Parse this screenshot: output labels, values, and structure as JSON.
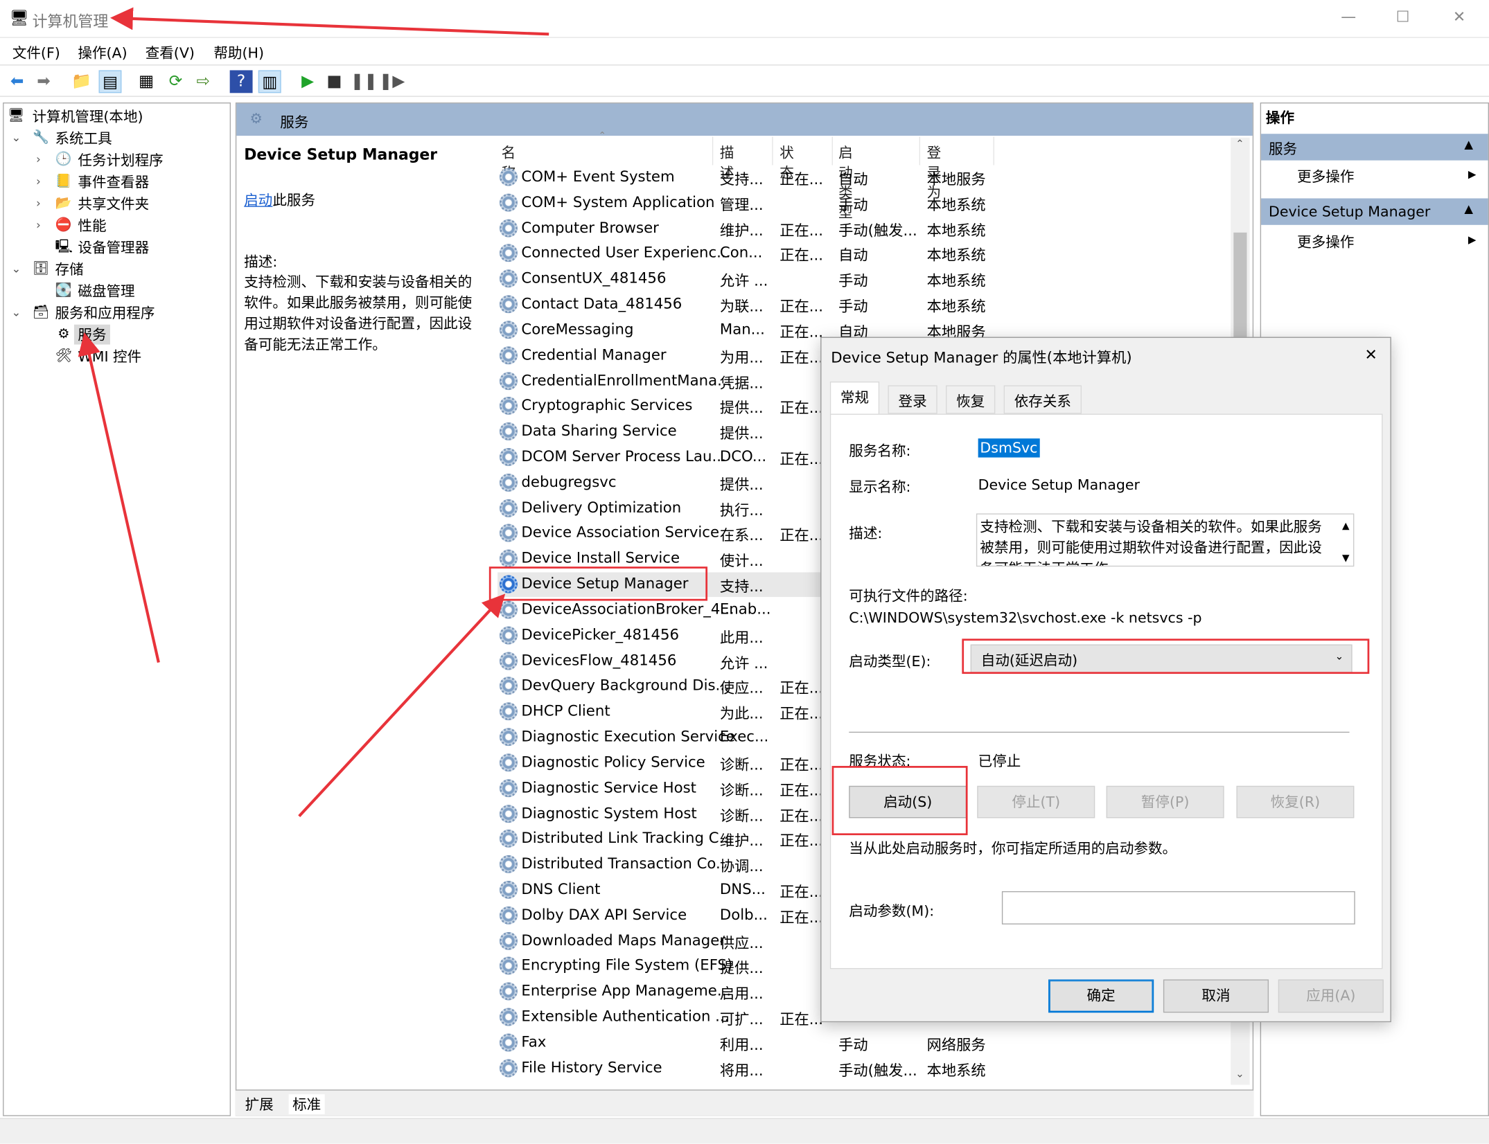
{
  "window": {
    "title": "计算机管理",
    "minimize": "—",
    "maximize": "☐",
    "close": "✕"
  },
  "menu": [
    "文件(F)",
    "操作(A)",
    "查看(V)",
    "帮助(H)"
  ],
  "toolbar": [
    "back-icon",
    "forward-icon",
    "up-folder-icon",
    "show-hide-tree-icon",
    "properties-icon",
    "refresh-icon",
    "export-list-icon",
    "help-icon",
    "show-hide-action-icon",
    "play-icon",
    "stop-icon",
    "pause-icon",
    "resume-icon"
  ],
  "tree": {
    "root": "计算机管理(本地)",
    "items": [
      {
        "label": "系统工具",
        "level": 1,
        "expanded": true
      },
      {
        "label": "任务计划程序",
        "level": 2
      },
      {
        "label": "事件查看器",
        "level": 2
      },
      {
        "label": "共享文件夹",
        "level": 2
      },
      {
        "label": "性能",
        "level": 2
      },
      {
        "label": "设备管理器",
        "level": 2
      },
      {
        "label": "存储",
        "level": 1,
        "expanded": true
      },
      {
        "label": "磁盘管理",
        "level": 2
      },
      {
        "label": "服务和应用程序",
        "level": 1,
        "expanded": true
      },
      {
        "label": "服务",
        "level": 2,
        "selected": true
      },
      {
        "label": "WMI 控件",
        "level": 2
      }
    ]
  },
  "services": {
    "header": "服务",
    "detail": {
      "title": "Device Setup Manager",
      "start_link": "启动",
      "start_suffix": "此服务",
      "desc_label": "描述:",
      "desc": "支持检测、下载和安装与设备相关的软件。如果此服务被禁用，则可能使用过期软件对设备进行配置，因此设备可能无法正常工作。"
    },
    "columns": [
      "名称",
      "描述",
      "状态",
      "启动类型",
      "登录为"
    ],
    "rows": [
      [
        "COM+ Event System",
        "支持...",
        "正在...",
        "自动",
        "本地服务"
      ],
      [
        "COM+ System Application",
        "管理...",
        "",
        "手动",
        "本地系统"
      ],
      [
        "Computer Browser",
        "维护...",
        "正在...",
        "手动(触发...",
        "本地系统"
      ],
      [
        "Connected User Experienc...",
        "Con...",
        "正在...",
        "自动",
        "本地系统"
      ],
      [
        "ConsentUX_481456",
        "允许 ...",
        "",
        "手动",
        "本地系统"
      ],
      [
        "Contact Data_481456",
        "为联...",
        "正在...",
        "手动",
        "本地系统"
      ],
      [
        "CoreMessaging",
        "Man...",
        "正在...",
        "自动",
        "本地服务"
      ],
      [
        "Credential Manager",
        "为用...",
        "正在...",
        "",
        ""
      ],
      [
        "CredentialEnrollmentMana...",
        "凭据...",
        "",
        "",
        ""
      ],
      [
        "Cryptographic Services",
        "提供...",
        "正在...",
        "",
        ""
      ],
      [
        "Data Sharing Service",
        "提供...",
        "",
        "",
        ""
      ],
      [
        "DCOM Server Process Lau...",
        "DCO...",
        "正在...",
        "",
        ""
      ],
      [
        "debugregsvc",
        "提供...",
        "",
        "",
        ""
      ],
      [
        "Delivery Optimization",
        "执行...",
        "",
        "",
        ""
      ],
      [
        "Device Association Service",
        "在系...",
        "正在...",
        "",
        ""
      ],
      [
        "Device Install Service",
        "使计...",
        "",
        "",
        ""
      ],
      [
        "Device Setup Manager",
        "支持...",
        "",
        "",
        ""
      ],
      [
        "DeviceAssociationBroker_4...",
        "Enab...",
        "",
        "",
        ""
      ],
      [
        "DevicePicker_481456",
        "此用...",
        "",
        "",
        ""
      ],
      [
        "DevicesFlow_481456",
        "允许 ...",
        "",
        "",
        ""
      ],
      [
        "DevQuery Background Dis...",
        "使应...",
        "正在...",
        "",
        ""
      ],
      [
        "DHCP Client",
        "为此...",
        "正在...",
        "",
        ""
      ],
      [
        "Diagnostic Execution Service",
        "Exec...",
        "",
        "",
        ""
      ],
      [
        "Diagnostic Policy Service",
        "诊断...",
        "正在...",
        "",
        ""
      ],
      [
        "Diagnostic Service Host",
        "诊断...",
        "正在...",
        "",
        ""
      ],
      [
        "Diagnostic System Host",
        "诊断...",
        "正在...",
        "",
        ""
      ],
      [
        "Distributed Link Tracking C...",
        "维护...",
        "正在...",
        "",
        ""
      ],
      [
        "Distributed Transaction Co...",
        "协调...",
        "",
        "",
        ""
      ],
      [
        "DNS Client",
        "DNS...",
        "正在...",
        "",
        ""
      ],
      [
        "Dolby DAX API Service",
        "Dolb...",
        "正在...",
        "",
        ""
      ],
      [
        "Downloaded Maps Manager",
        "供应...",
        "",
        "",
        ""
      ],
      [
        "Encrypting File System (EFS)",
        "提供...",
        "",
        "",
        ""
      ],
      [
        "Enterprise App Manageme...",
        "启用...",
        "",
        "",
        ""
      ],
      [
        "Extensible Authentication ...",
        "可扩...",
        "正在...",
        "",
        ""
      ],
      [
        "Fax",
        "利用...",
        "",
        "手动",
        "网络服务"
      ],
      [
        "File History Service",
        "将用...",
        "",
        "手动(触发...",
        "本地系统"
      ]
    ],
    "selected_row": 16,
    "bottom_tabs": [
      "扩展",
      "标准"
    ]
  },
  "actions": {
    "title": "操作",
    "groups": [
      {
        "header": "服务",
        "item": "更多操作"
      },
      {
        "header": "Device Setup Manager",
        "item": "更多操作"
      }
    ]
  },
  "dialog": {
    "title": "Device Setup Manager 的属性(本地计算机)",
    "tabs": [
      "常规",
      "登录",
      "恢复",
      "依存关系"
    ],
    "service_name_label": "服务名称:",
    "service_name": "DsmSvc",
    "display_name_label": "显示名称:",
    "display_name": "Device Setup Manager",
    "desc_label": "描述:",
    "desc": "支持检测、下载和安装与设备相关的软件。如果此服务被禁用，则可能使用过期软件对设备进行配置，因此设备可能无法正常工作。",
    "path_label": "可执行文件的路径:",
    "path": "C:\\WINDOWS\\system32\\svchost.exe -k netsvcs -p",
    "startup_label": "启动类型(E):",
    "startup_value": "自动(延迟启动)",
    "status_label": "服务状态:",
    "status_value": "已停止",
    "buttons": {
      "start": "启动(S)",
      "stop": "停止(T)",
      "pause": "暂停(P)",
      "resume": "恢复(R)"
    },
    "hint": "当从此处启动服务时，你可指定所适用的启动参数。",
    "params_label": "启动参数(M):",
    "params_value": "",
    "ok": "确定",
    "cancel": "取消",
    "apply": "应用(A)"
  },
  "colors": {
    "annotation": "#e8333a",
    "header_bar": "#9fb6d2",
    "selection": "#0078d7"
  }
}
